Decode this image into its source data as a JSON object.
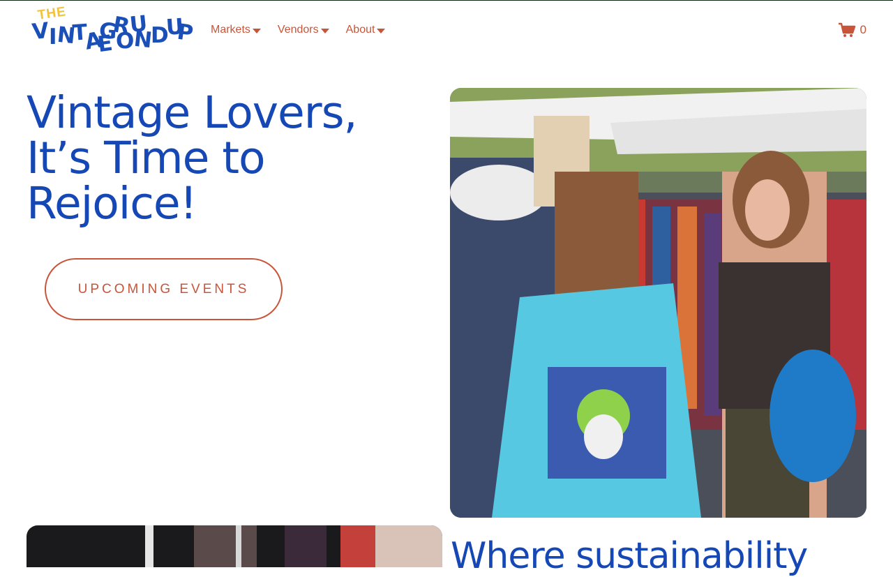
{
  "brand": {
    "logo_the": "THE",
    "logo_letters": [
      "V",
      "I",
      "N",
      "T",
      "A",
      "G",
      "E",
      "R",
      "O",
      "U",
      "N",
      "D",
      "U",
      "P"
    ],
    "logo_colors": {
      "primary": "#1a4fb8",
      "accent": "#f2c33a"
    }
  },
  "nav": {
    "items": [
      {
        "label": "Markets",
        "icon": "caret-down-icon"
      },
      {
        "label": "Vendors",
        "icon": "caret-down-icon"
      },
      {
        "label": "About",
        "icon": "caret-down-icon"
      }
    ]
  },
  "cart": {
    "icon": "shopping-cart-icon",
    "count": "0"
  },
  "hero": {
    "title_line1": "Vintage Lovers,",
    "title_line2": "It’s Time to",
    "title_line3": "Rejoice!",
    "cta_label": "UPCOMING EVENTS",
    "image": "market-shoppers-photo"
  },
  "section2": {
    "title": "Where sustainability",
    "image": "clothing-rack-photo"
  },
  "colors": {
    "headline": "#1547b5",
    "accent": "#c8553a"
  }
}
